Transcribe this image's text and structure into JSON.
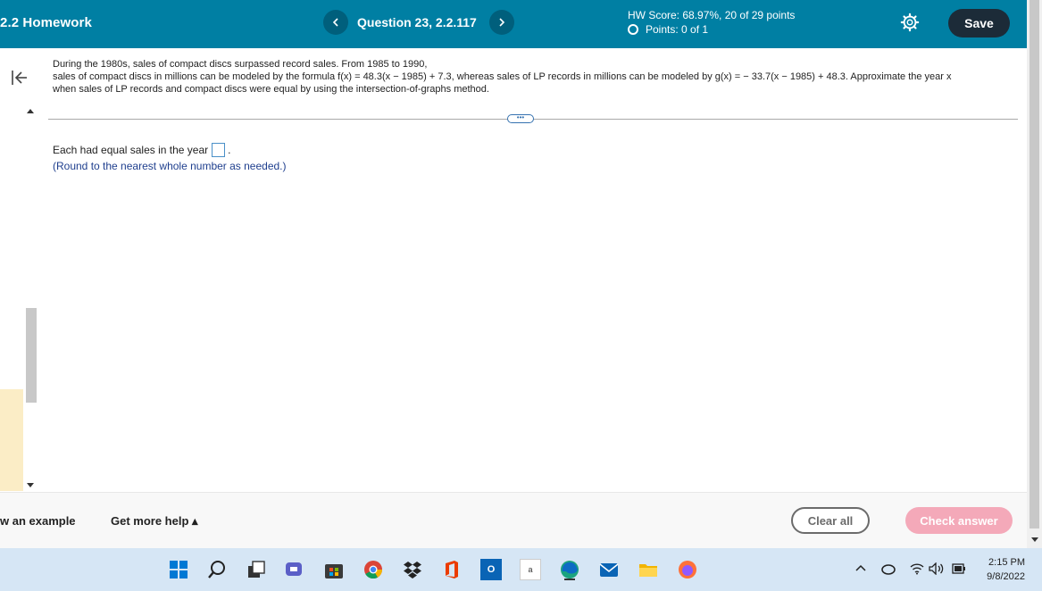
{
  "header": {
    "title": "2.2 Homework",
    "question_label": "Question 23, 2.2.117",
    "prev_icon": "chevron-left-icon",
    "next_icon": "chevron-right-icon",
    "hw_score": "HW Score: 68.97%, 20 of 29 points",
    "points": "Points: 0 of 1",
    "settings_icon": "gear-icon",
    "save_label": "Save",
    "accent_color": "#007fa3"
  },
  "question": {
    "line1": "During the 1980s, sales of compact discs surpassed record sales. From 1985 to 1990,",
    "line2": "sales of compact discs in millions can be modeled by the formula f(x) = 48.3(x − 1985) + 7.3, whereas sales of LP records in millions can be modeled by g(x) = − 33.7(x − 1985) + 48.3. Approximate the year x",
    "line3": "when sales of LP records and compact discs were equal by using the intersection-of-graphs method.",
    "more_dots": "•••"
  },
  "answer": {
    "prefix": "Each had equal sales in the year",
    "suffix": ".",
    "value": "",
    "hint": "(Round to the nearest whole number as needed.)"
  },
  "bottom": {
    "example_label": "w an example",
    "help_label": "Get more help ▴",
    "clear_label": "Clear all",
    "check_label": "Check answer",
    "check_color": "#f4a9b9"
  },
  "taskbar": {
    "amazon_label": "a",
    "outlook_label": "O",
    "time": "2:15 PM",
    "date": "9/8/2022"
  }
}
